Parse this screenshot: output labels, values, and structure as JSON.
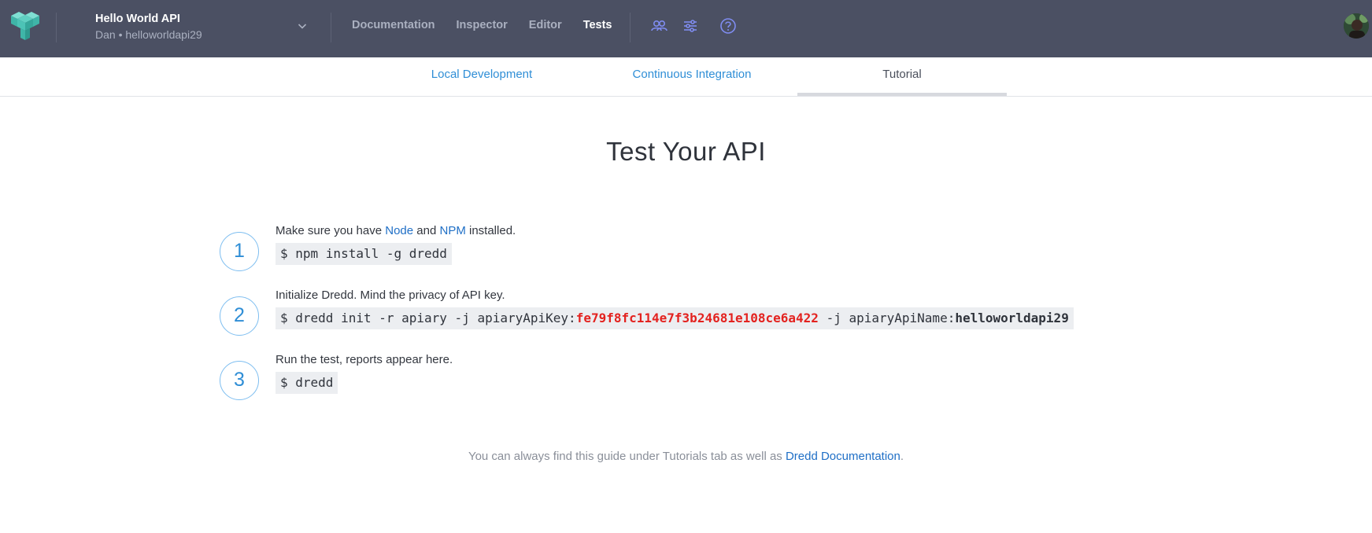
{
  "header": {
    "api_name": "Hello World API",
    "api_subtitle": "Dan • helloworldapi29",
    "nav": [
      {
        "label": "Documentation",
        "active": false
      },
      {
        "label": "Inspector",
        "active": false
      },
      {
        "label": "Editor",
        "active": false
      },
      {
        "label": "Tests",
        "active": true
      }
    ],
    "icons": [
      "team-icon",
      "settings-sliders-icon",
      "help-icon"
    ]
  },
  "subtabs": [
    {
      "label": "Local Development",
      "active": false
    },
    {
      "label": "Continuous Integration",
      "active": false
    },
    {
      "label": "Tutorial",
      "active": true
    }
  ],
  "main": {
    "title": "Test Your API",
    "steps": [
      {
        "number": "1",
        "text_before": "Make sure you have ",
        "link1": "Node",
        "text_middle": " and ",
        "link2": "NPM",
        "text_after": " installed.",
        "code": "$ npm install -g dredd"
      },
      {
        "number": "2",
        "text": "Initialize Dredd. Mind the privacy of API key.",
        "code_prefix": "$ dredd init -r apiary -j apiaryApiKey:",
        "api_key": "fe79f8fc114e7f3b24681e108ce6a422",
        "code_middle": " -j apiaryApiName:",
        "api_name": "helloworldapi29"
      },
      {
        "number": "3",
        "text": "Run the test, reports appear here.",
        "code": "$ dredd"
      }
    ],
    "footer_text": "You can always find this guide under Tutorials tab as well as ",
    "footer_link": "Dredd Documentation",
    "footer_end": "."
  },
  "colors": {
    "topbar": "#4b5063",
    "accent": "#2f8ed6",
    "api_key": "#e3221f",
    "logo": "#4fc4b9"
  }
}
